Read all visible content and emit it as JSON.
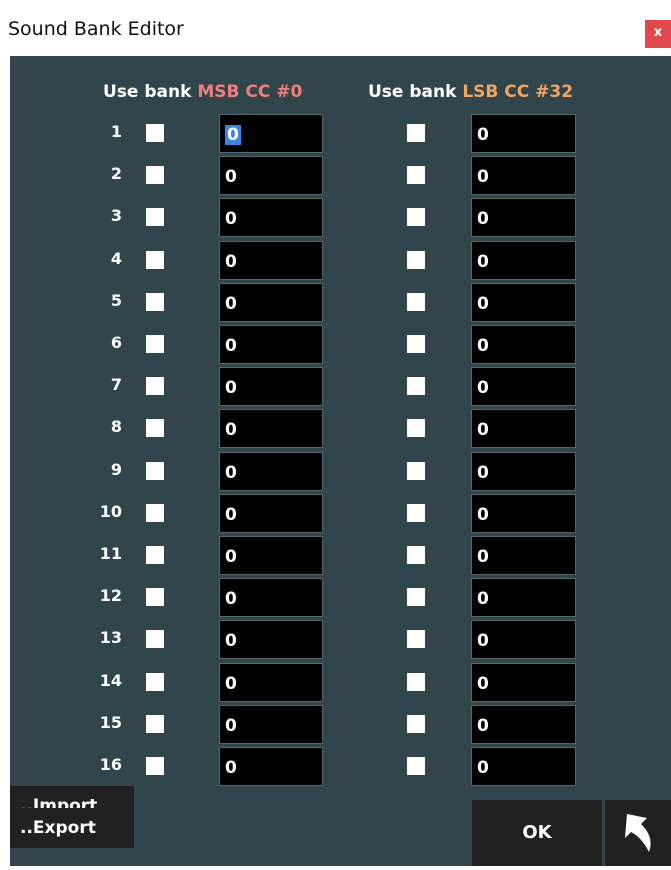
{
  "window": {
    "title": "Sound Bank Editor",
    "close_label": "x"
  },
  "header": {
    "use_bank_label_1": "Use bank",
    "msb_label": "MSB CC #0",
    "use_bank_label_2": "Use bank",
    "lsb_label": "LSB CC #32"
  },
  "rows": [
    {
      "num": "1",
      "msb_checked": false,
      "msb_value": "0",
      "lsb_checked": false,
      "lsb_value": "0"
    },
    {
      "num": "2",
      "msb_checked": false,
      "msb_value": "0",
      "lsb_checked": false,
      "lsb_value": "0"
    },
    {
      "num": "3",
      "msb_checked": false,
      "msb_value": "0",
      "lsb_checked": false,
      "lsb_value": "0"
    },
    {
      "num": "4",
      "msb_checked": false,
      "msb_value": "0",
      "lsb_checked": false,
      "lsb_value": "0"
    },
    {
      "num": "5",
      "msb_checked": false,
      "msb_value": "0",
      "lsb_checked": false,
      "lsb_value": "0"
    },
    {
      "num": "6",
      "msb_checked": false,
      "msb_value": "0",
      "lsb_checked": false,
      "lsb_value": "0"
    },
    {
      "num": "7",
      "msb_checked": false,
      "msb_value": "0",
      "lsb_checked": false,
      "lsb_value": "0"
    },
    {
      "num": "8",
      "msb_checked": false,
      "msb_value": "0",
      "lsb_checked": false,
      "lsb_value": "0"
    },
    {
      "num": "9",
      "msb_checked": false,
      "msb_value": "0",
      "lsb_checked": false,
      "lsb_value": "0"
    },
    {
      "num": "10",
      "msb_checked": false,
      "msb_value": "0",
      "lsb_checked": false,
      "lsb_value": "0"
    },
    {
      "num": "11",
      "msb_checked": false,
      "msb_value": "0",
      "lsb_checked": false,
      "lsb_value": "0"
    },
    {
      "num": "12",
      "msb_checked": false,
      "msb_value": "0",
      "lsb_checked": false,
      "lsb_value": "0"
    },
    {
      "num": "13",
      "msb_checked": false,
      "msb_value": "0",
      "lsb_checked": false,
      "lsb_value": "0"
    },
    {
      "num": "14",
      "msb_checked": false,
      "msb_value": "0",
      "lsb_checked": false,
      "lsb_value": "0"
    },
    {
      "num": "15",
      "msb_checked": false,
      "msb_value": "0",
      "lsb_checked": false,
      "lsb_value": "0"
    },
    {
      "num": "16",
      "msb_checked": false,
      "msb_value": "0",
      "lsb_checked": false,
      "lsb_value": "0"
    }
  ],
  "footer": {
    "import_label": "..Import",
    "export_label": "..Export",
    "ok_label": "OK",
    "undo_icon": "undo-arrow-icon"
  },
  "colors": {
    "background": "#31454d",
    "msb_accent": "#f08080",
    "lsb_accent": "#f4a460",
    "close_button": "#e0474f",
    "field_background": "#000000",
    "button_background": "#212121"
  }
}
